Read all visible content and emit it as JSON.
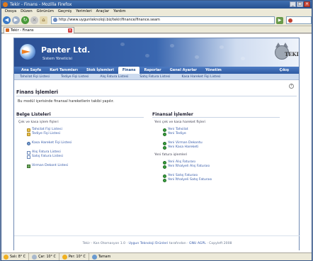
{
  "browser": {
    "window_title": "Tekir - Finans - Mozilla Firefox",
    "menu": [
      "Dosya",
      "Düzen",
      "Görünüm",
      "Geçmiş",
      "Yerimleri",
      "Araçlar",
      "Yardım"
    ],
    "url": "http://www.uygunteknoloji.biz/tekir/finance/finance.seam",
    "tab_title": "Tekir - Finans"
  },
  "header": {
    "brand": "Panter Ltd.",
    "subtitle": "Sistem Yöneticisi",
    "mascot_text": "TEKIR"
  },
  "main_nav": {
    "items": [
      "Ana Sayfa",
      "Kart Tanımları",
      "Stok İşlemleri",
      "Finans",
      "Raporlar",
      "Genel Ayarlar",
      "Yönetim"
    ],
    "active": "Finans",
    "exit": "Çıkış"
  },
  "sub_nav": [
    "Tahsilat Fişi Listesi",
    "Tediye Fişi Listesi",
    "Alış Fatura Listesi",
    "Satış Fatura Listesi",
    "Kasa Hareket Fişi Listesi"
  ],
  "page": {
    "title": "Finans İşlemleri",
    "intro": "Bu modül içerisinde finansal hareketlerin takibi yapılır.",
    "help_label": "?"
  },
  "lists": {
    "heading": "Belge Listeleri",
    "desc": "Çek ve kasa işlem fişleri",
    "groups": [
      [
        {
          "icon": "folder-icon",
          "label": "Tahsilat Fişi Listesi"
        },
        {
          "icon": "folder-icon",
          "label": "Tediye Fişi Listesi"
        }
      ],
      [
        {
          "icon": "gear-icon",
          "label": "Kasa Hareket Fişi Listesi"
        }
      ],
      [
        {
          "icon": "document-icon",
          "label": "Alış Fatura Listesi"
        },
        {
          "icon": "document-icon",
          "label": "Satış Fatura Listesi"
        }
      ],
      [
        {
          "icon": "chart-icon",
          "label": "Virman Dekont Listesi"
        }
      ]
    ]
  },
  "ops": {
    "heading": "Finansal İşlemler",
    "desc1": "Yeni çek ve kasa hareket fişleri",
    "group1": [
      "Yeni Tahsilat",
      "Yeni Tediye"
    ],
    "group2": [
      "Yeni Virman Dekontu",
      "Yeni Kasa Hareketi"
    ],
    "desc2": "Yeni fatura işlemleri",
    "group3": [
      "Yeni Alış Faturası",
      "Yeni İthalyeli Alış Faturası"
    ],
    "group4": [
      "Yeni Satış Faturası",
      "Yeni İthalyeli Satış Faturası"
    ]
  },
  "footer": {
    "prefix": "Tekir - Kan Otomasyon 1.0 · ",
    "link1": "Uygun Teknoloji Ürünleri",
    "middle": " tarafından · ",
    "link2": "GNU AGPL",
    "suffix": " · Copyleft 2008"
  },
  "status": {
    "weather1": "Salı: 8° C",
    "weather2": "Çar: 10° C",
    "weather3": "Per: 10° C",
    "done": "Tamam"
  },
  "colors": {
    "accent": "#2e5aa2",
    "link": "#3358a8",
    "subnav_bg": "#cddbef"
  }
}
